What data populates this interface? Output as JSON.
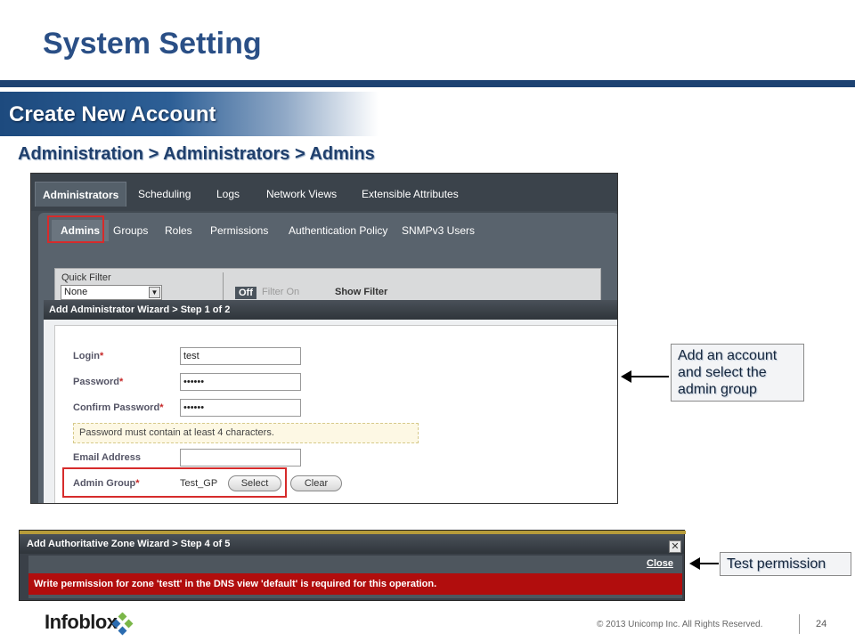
{
  "slide": {
    "title": "System Setting",
    "section": "Create New Account",
    "breadcrumb": "Administration > Administrators > Admins"
  },
  "admin_ui": {
    "tabs": [
      "Administrators",
      "Scheduling",
      "Logs",
      "Network Views",
      "Extensible Attributes"
    ],
    "active_tab": "Administrators",
    "subtabs": [
      "Admins",
      "Groups",
      "Roles",
      "Permissions",
      "Authentication Policy",
      "SNMPv3 Users"
    ],
    "active_subtab": "Admins",
    "quick_filter": {
      "label": "Quick Filter",
      "value": "None",
      "off_label": "Off",
      "filter_on_label": "Filter On",
      "show_filter_label": "Show Filter"
    }
  },
  "wizard": {
    "title": "Add Administrator Wizard > Step 1 of 2",
    "login_label": "Login",
    "login_value": "test",
    "password_label": "Password",
    "password_value": "••••••",
    "confirm_label": "Confirm Password",
    "confirm_value": "••••••",
    "required_mark": "*",
    "hint": "Password must contain at least 4 characters.",
    "email_label": "Email Address",
    "email_value": "",
    "admin_group_label": "Admin Group",
    "admin_group_value": "Test_GP",
    "select_button": "Select",
    "clear_button": "Clear"
  },
  "callouts": {
    "account": "Add an account and select the admin group",
    "permission": "Test permission"
  },
  "zone_wizard": {
    "title": "Add Authoritative Zone Wizard > Step 4 of 5",
    "close_x": "✕",
    "close_link": "Close",
    "error": "Write permission for zone 'testt' in the DNS view 'default' is required for this operation."
  },
  "footer": {
    "logo": "Infoblox",
    "copyright": "© 2013 Unicomp Inc. All Rights Reserved.",
    "page_number": "24"
  },
  "colors": {
    "title_blue": "#2a4f86",
    "rule_navy": "#1d4272",
    "highlight_red": "#d62b2b",
    "error_red": "#b10d0d",
    "logo_green": "#7ab648",
    "logo_blue": "#2b6cb0"
  }
}
